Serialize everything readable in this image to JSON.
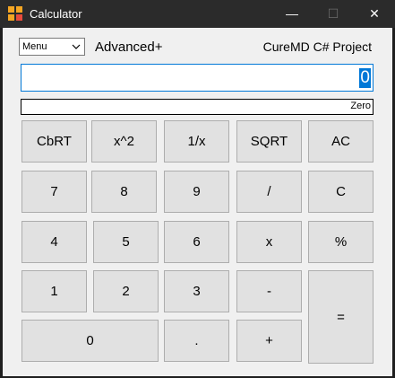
{
  "window": {
    "title": "Calculator",
    "controls": {
      "minimize": "—",
      "maximize": "☐",
      "close": "✕"
    }
  },
  "header": {
    "menu_value": "Menu",
    "advanced_label": "Advanced+",
    "project_label": "CureMD C# Project"
  },
  "display": {
    "value": "0",
    "words": "Zero"
  },
  "keys": {
    "cbrt": "CbRT",
    "square": "x^2",
    "reciprocal": "1/x",
    "sqrt": "SQRT",
    "all_clear": "AC",
    "seven": "7",
    "eight": "8",
    "nine": "9",
    "divide": "/",
    "clear": "C",
    "four": "4",
    "five": "5",
    "six": "6",
    "multiply": "x",
    "percent": "%",
    "one": "1",
    "two": "2",
    "three": "3",
    "subtract": "-",
    "equals": "=",
    "zero": "0",
    "decimal": ".",
    "add": "+"
  },
  "icons": {
    "app": "calculator-app-icon",
    "dropdown": "chevron-down-icon"
  },
  "colors": {
    "titlebar": "#2b2b2b",
    "client": "#f0f0f0",
    "key": "#e1e1e1",
    "key_border": "#adadad",
    "accent": "#0078d7"
  }
}
